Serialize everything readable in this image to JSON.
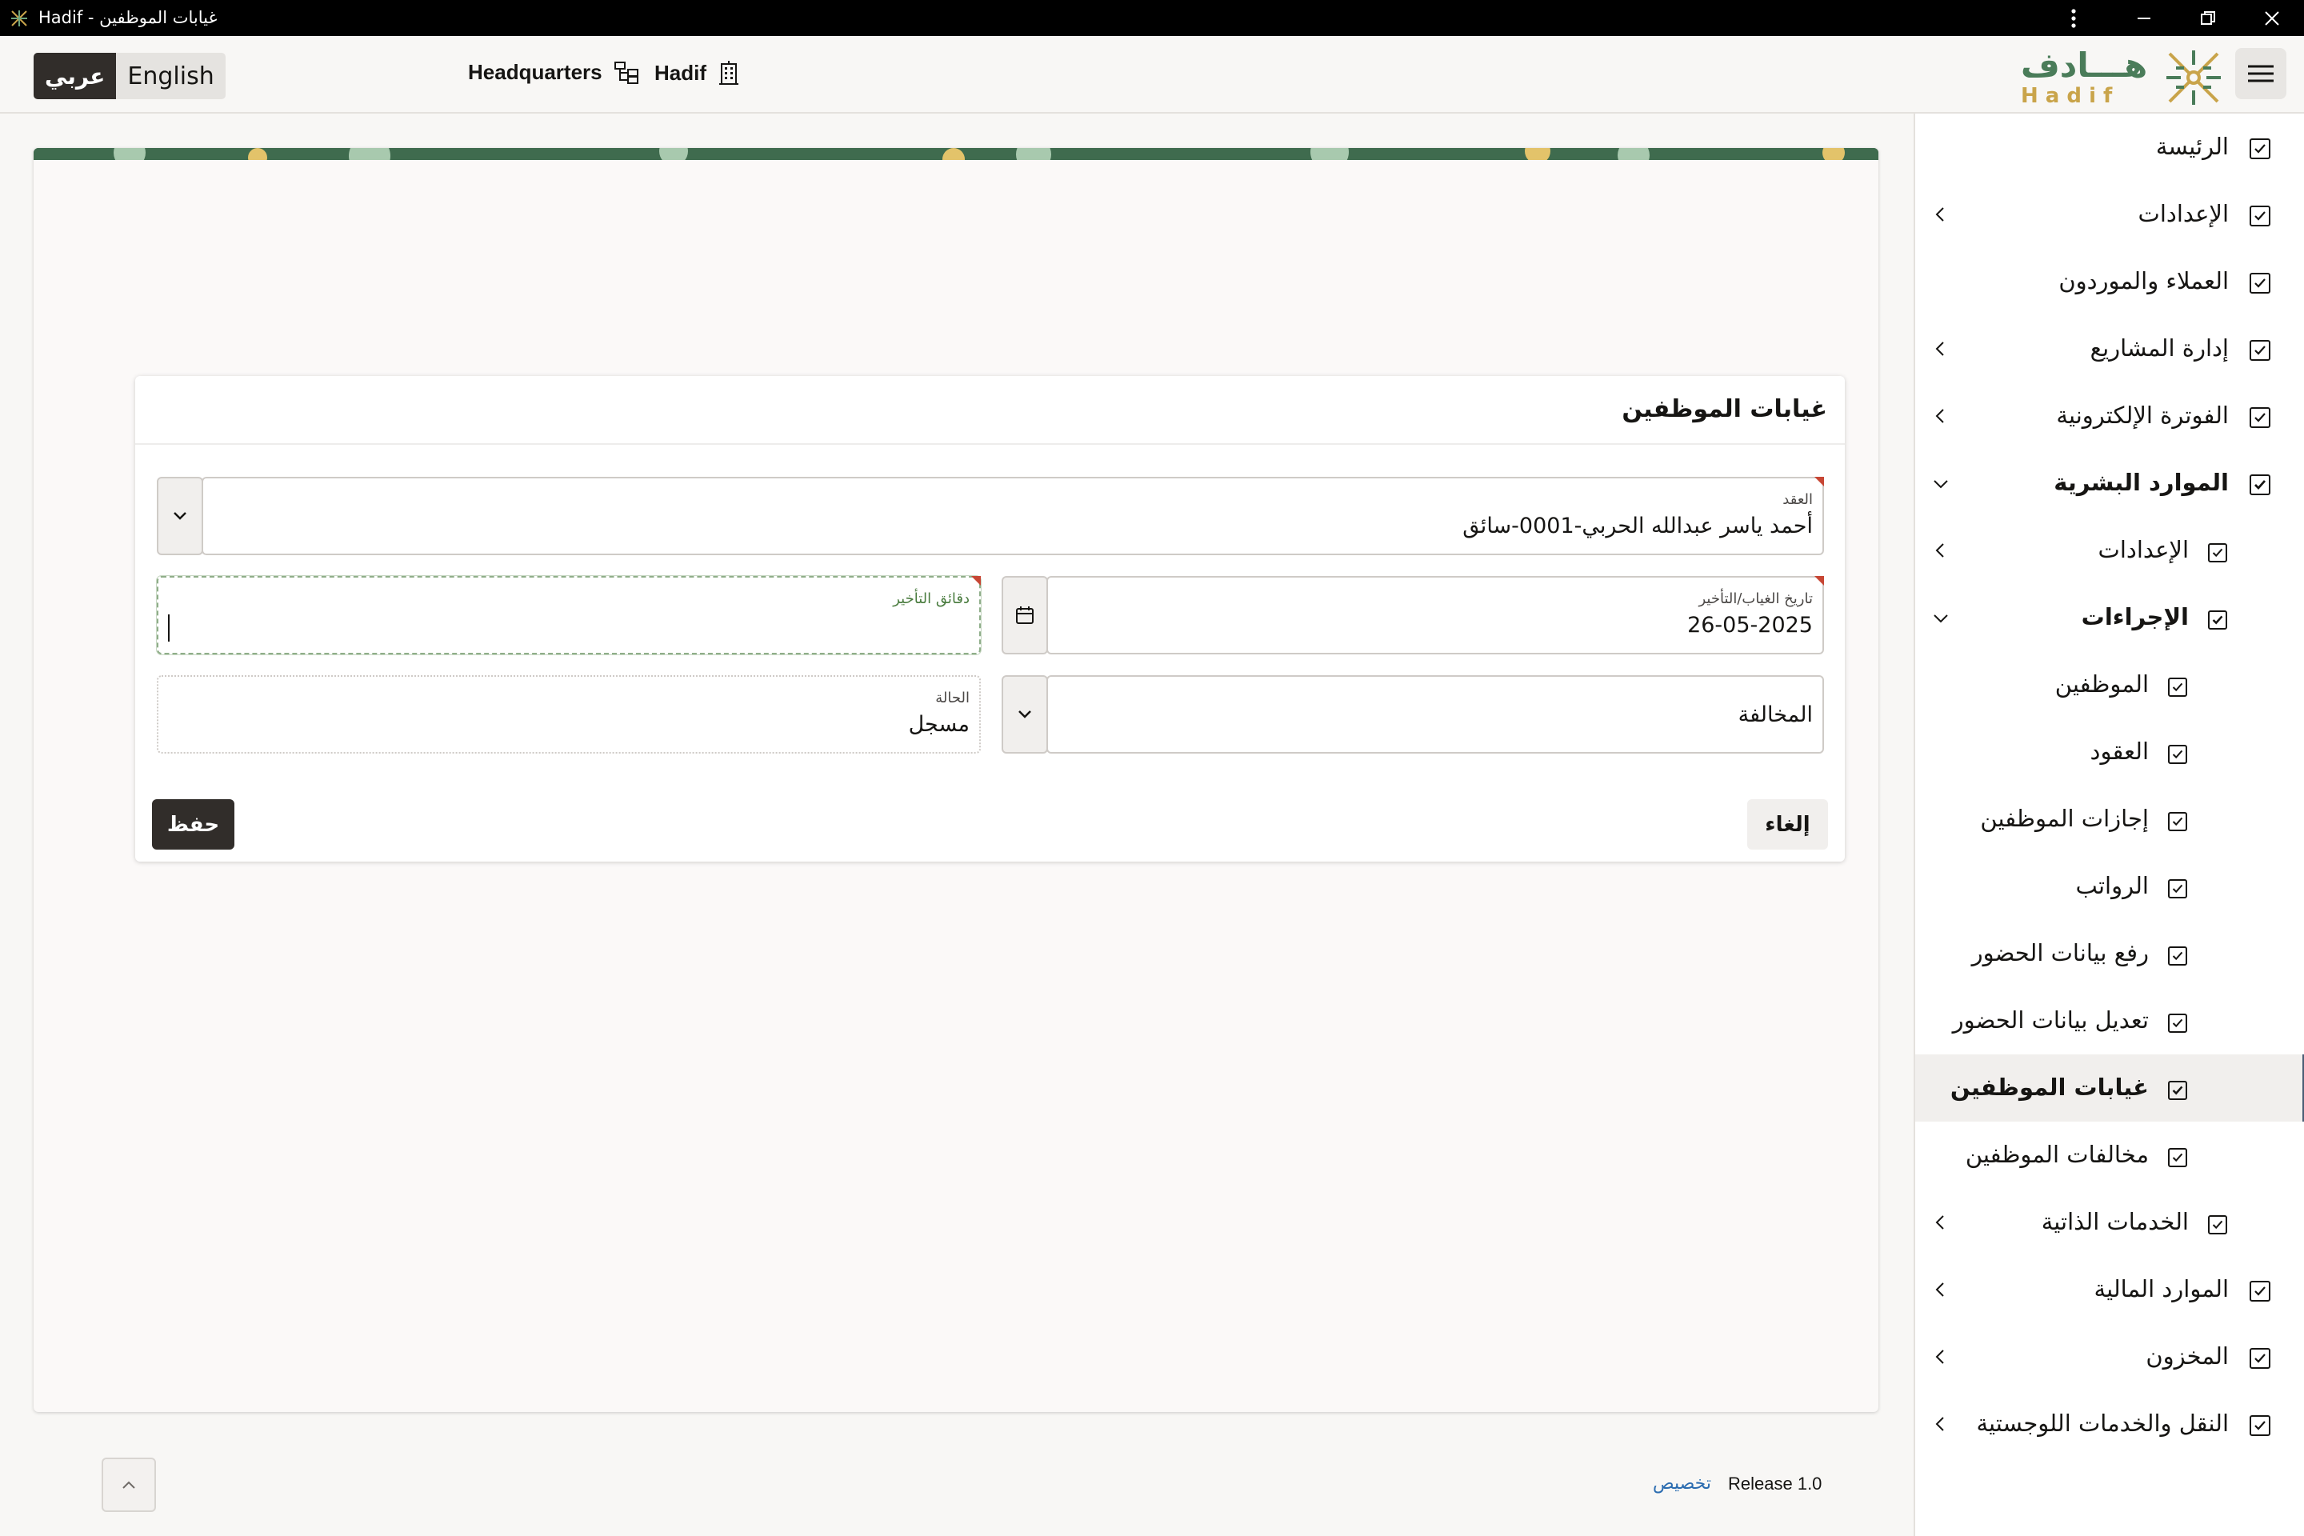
{
  "window": {
    "title": "غيابات الموظفين - Hadif"
  },
  "header": {
    "lang_arabic": "عربي",
    "lang_english": "English",
    "org_label": "Headquarters",
    "company_label": "Hadif",
    "brand_arabic": "هـــادف",
    "brand_latin": "H a d i f"
  },
  "sidebar": {
    "items": [
      {
        "label": "الرئيسة"
      },
      {
        "label": "الإعدادات"
      },
      {
        "label": "العملاء والموردون"
      },
      {
        "label": "إدارة المشاريع"
      },
      {
        "label": "الفوترة الإلكترونية"
      },
      {
        "label": "الموارد البشرية"
      },
      {
        "label": "الإعدادات"
      },
      {
        "label": "الإجراءات"
      },
      {
        "label": "الموظفين"
      },
      {
        "label": "العقود"
      },
      {
        "label": "إجازات الموظفين"
      },
      {
        "label": "الرواتب"
      },
      {
        "label": "رفع بيانات الحضور"
      },
      {
        "label": "تعديل بيانات الحضور"
      },
      {
        "label": "غيابات الموظفين"
      },
      {
        "label": "مخالفات الموظفين"
      },
      {
        "label": "الخدمات الذاتية"
      },
      {
        "label": "الموارد المالية"
      },
      {
        "label": "المخزون"
      },
      {
        "label": "النقل والخدمات اللوجستية"
      }
    ]
  },
  "form": {
    "title": "غيابات الموظفين",
    "contract_label": "العقد",
    "contract_value": "أحمد ياسر عبدالله  الحربي-0001-سائق",
    "date_label": "تاريخ الغياب/التأخير",
    "date_value": "26-05-2025",
    "late_minutes_label": "دقائق التأخير",
    "late_minutes_value": "",
    "violation_placeholder": "المخالفة",
    "status_label": "الحالة",
    "status_value": "مسجل",
    "cancel_label": "إلغاء",
    "save_label": "حفظ"
  },
  "footer": {
    "release": "Release 1.0",
    "customize": "تخصيص"
  },
  "colors": {
    "accent_dark": "#312d2a",
    "required_marker": "#c74634",
    "nav_active_bar": "#4a5d75",
    "brand_green": "#4a7c59",
    "brand_gold": "#c9a44a"
  }
}
